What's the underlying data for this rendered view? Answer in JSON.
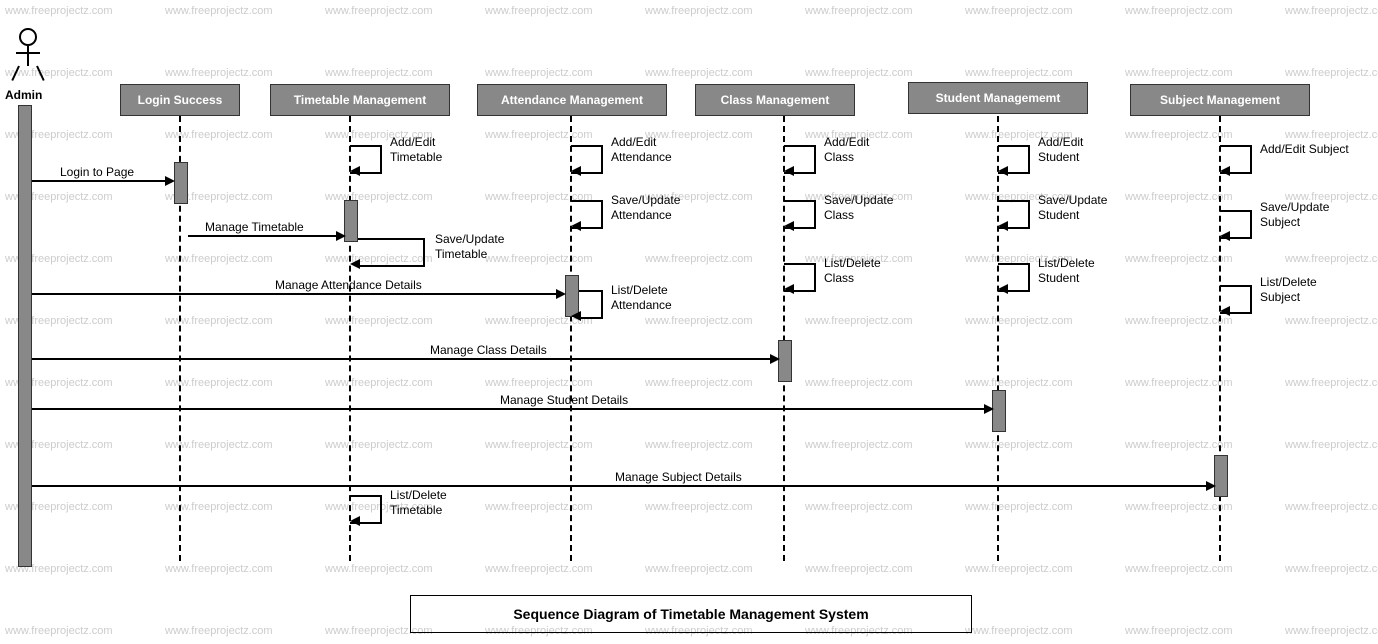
{
  "actor": {
    "name": "Admin"
  },
  "lifelines": [
    {
      "label": "Login Success"
    },
    {
      "label": "Timetable Management"
    },
    {
      "label": "Attendance Management"
    },
    {
      "label": "Class Management"
    },
    {
      "label": "Student Managememt"
    },
    {
      "label": "Subject Management"
    }
  ],
  "messages": {
    "login": "Login to Page",
    "manage_timetable": "Manage Timetable",
    "manage_attendance": "Manage Attendance Details",
    "manage_class": "Manage Class Details",
    "manage_student": "Manage Student Details",
    "manage_subject": "Manage Subject Details",
    "timetable_add": "Add/Edit Timetable",
    "timetable_save": "Save/Update Timetable",
    "timetable_list": "List/Delete Timetable",
    "attendance_add": "Add/Edit Attendance",
    "attendance_save": "Save/Update Attendance",
    "attendance_list": "List/Delete Attendance",
    "class_add": "Add/Edit Class",
    "class_save": "Save/Update Class",
    "class_list": "List/Delete Class",
    "student_add": "Add/Edit Student",
    "student_save": "Save/Update Student",
    "student_list": "List/Delete Student",
    "subject_add": "Add/Edit Subject",
    "subject_save": "Save/Update Subject",
    "subject_list": "List/Delete Subject"
  },
  "title": "Sequence Diagram of Timetable Management System",
  "watermark": "www.freeprojectz.com"
}
